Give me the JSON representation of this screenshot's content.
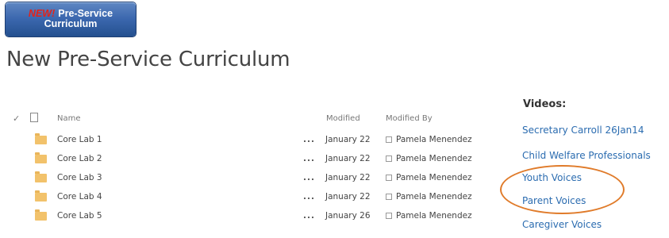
{
  "banner": {
    "new_label": "NEW!",
    "title_line1": "Pre-Service",
    "title_line2": "Curriculum"
  },
  "page_title": "New Pre-Service Curriculum",
  "table": {
    "headers": {
      "name": "Name",
      "modified": "Modified",
      "modified_by": "Modified By"
    },
    "rows": [
      {
        "name": "Core Lab 1",
        "actions": "...",
        "modified": "January 22",
        "modified_by": "Pamela Menendez"
      },
      {
        "name": "Core Lab 2",
        "actions": "...",
        "modified": "January 22",
        "modified_by": "Pamela Menendez"
      },
      {
        "name": "Core Lab 3",
        "actions": "...",
        "modified": "January 22",
        "modified_by": "Pamela Menendez"
      },
      {
        "name": "Core Lab 4",
        "actions": "...",
        "modified": "January 22",
        "modified_by": "Pamela Menendez"
      },
      {
        "name": "Core Lab 5",
        "actions": "...",
        "modified": "January 26",
        "modified_by": "Pamela Menendez"
      }
    ]
  },
  "videos": {
    "title": "Videos:",
    "links": [
      "Secretary Carroll 26Jan14",
      "Child Welfare Professionals",
      "Youth Voices",
      "Parent Voices",
      "Caregiver Voices"
    ]
  },
  "colors": {
    "link": "#2b6cb0",
    "highlight_oval": "#e07b2a",
    "banner_blue": "#3a66ad",
    "banner_new": "#e2231a"
  }
}
